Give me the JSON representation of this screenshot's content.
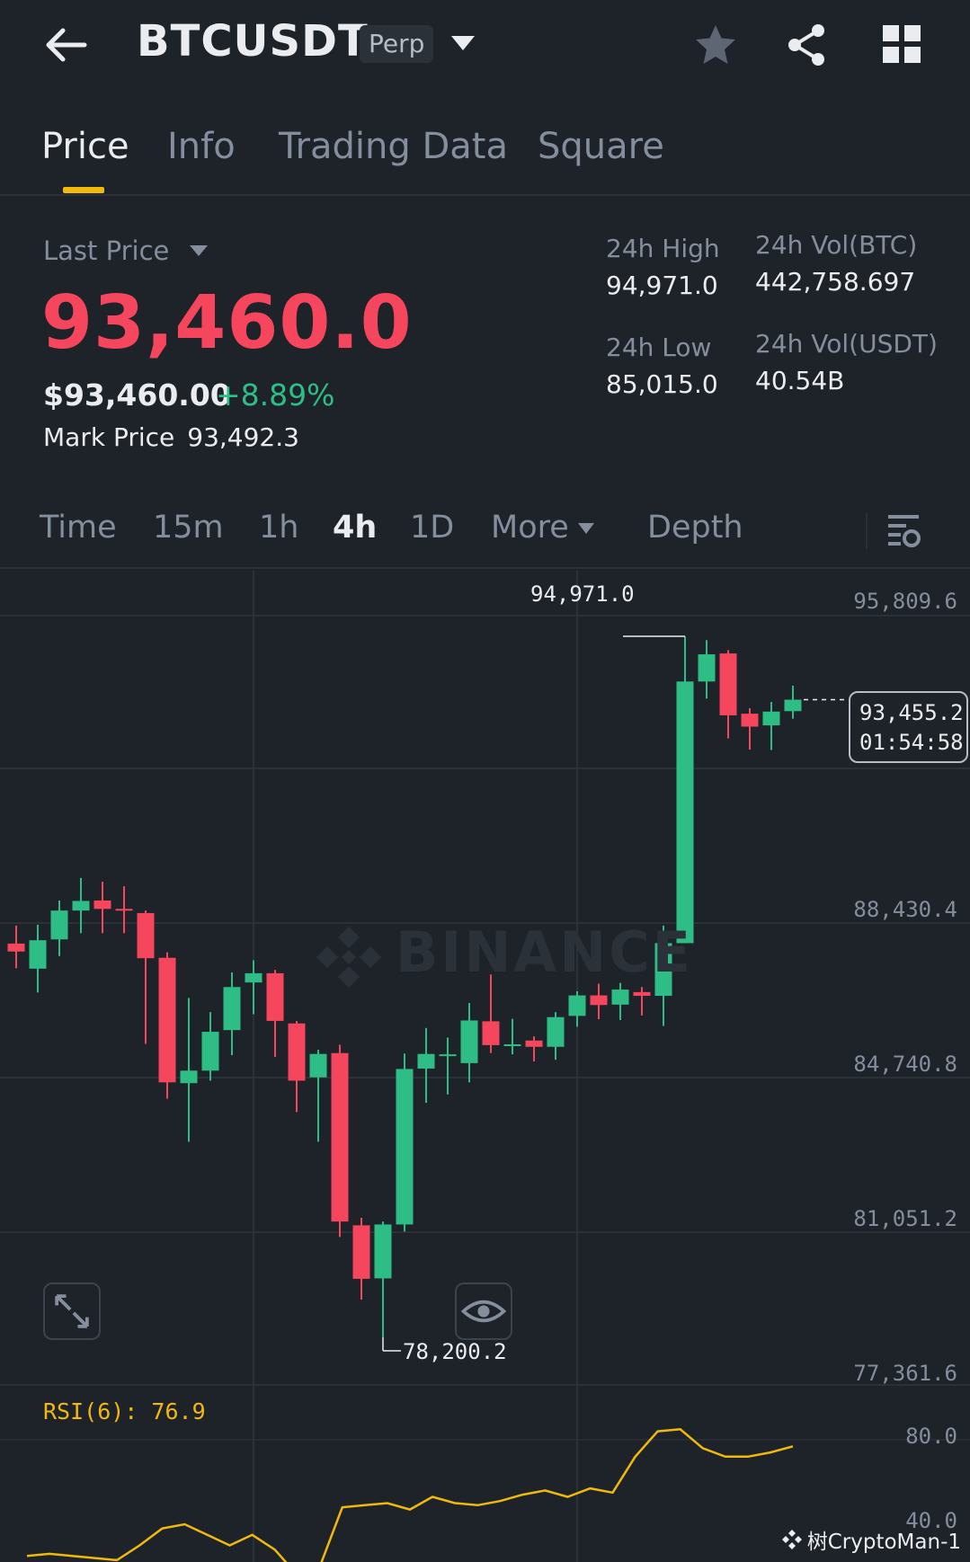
{
  "header": {
    "symbol": "BTCUSDT",
    "contract_type": "Perp",
    "icons": [
      "back-arrow-icon",
      "caret-down-icon",
      "star-icon",
      "share-icon",
      "grid-icon"
    ]
  },
  "tabs": [
    {
      "label": "Price",
      "active": true
    },
    {
      "label": "Info",
      "active": false
    },
    {
      "label": "Trading Data",
      "active": false
    },
    {
      "label": "Square",
      "active": false
    }
  ],
  "summary": {
    "last_price_label": "Last Price",
    "last_price": "93,460.0",
    "usd_price": "$93,460.00",
    "change_pct": "+8.89%",
    "mark_price_label": "Mark Price",
    "mark_price": "93,492.3",
    "high_label": "24h High",
    "high_value": "94,971.0",
    "low_label": "24h Low",
    "low_value": "85,015.0",
    "vol_btc_label": "24h Vol(BTC)",
    "vol_btc_value": "442,758.697",
    "vol_usdt_label": "24h Vol(USDT)",
    "vol_usdt_value": "40.54B"
  },
  "intervals": {
    "items": [
      {
        "label": "Time",
        "active": false
      },
      {
        "label": "15m",
        "active": false
      },
      {
        "label": "1h",
        "active": false
      },
      {
        "label": "4h",
        "active": true
      },
      {
        "label": "1D",
        "active": false
      },
      {
        "label": "More",
        "active": false
      },
      {
        "label": "Depth",
        "active": false
      }
    ]
  },
  "colors": {
    "up": "#2ebd85",
    "down": "#f6465d",
    "accent": "#f0b90b",
    "background": "#1e2329"
  },
  "chart_data": {
    "type": "candlestick",
    "interval": "4h",
    "y_ticks": [
      "95,809.6",
      "88,430.4",
      "84,740.8",
      "81,051.2",
      "77,361.6"
    ],
    "ylim": [
      77361.6,
      95809.6
    ],
    "high_marker": "94,971.0",
    "low_marker": "78,200.2",
    "current_price": "93,455.2",
    "countdown": "01:54:58",
    "watermark": "BINANCE",
    "candles": [
      [
        87620,
        87430,
        88050,
        87030
      ],
      [
        87020,
        87700,
        88070,
        86450
      ],
      [
        87720,
        88410,
        88650,
        87320
      ],
      [
        88410,
        88640,
        89190,
        87870
      ],
      [
        88650,
        88450,
        89100,
        87870
      ],
      [
        88450,
        88410,
        88990,
        87870
      ],
      [
        88350,
        87270,
        88410,
        85220
      ],
      [
        87280,
        84300,
        87410,
        83910
      ],
      [
        84280,
        84580,
        86320,
        82880
      ],
      [
        84580,
        85510,
        85980,
        84340
      ],
      [
        85550,
        86580,
        86930,
        84950
      ],
      [
        86690,
        86910,
        87220,
        85930
      ],
      [
        86910,
        85770,
        86990,
        84910
      ],
      [
        85710,
        84340,
        85770,
        83590
      ],
      [
        84420,
        84980,
        85080,
        82880
      ],
      [
        85000,
        80970,
        85200,
        80600
      ],
      [
        80880,
        79600,
        81060,
        79100
      ],
      [
        79610,
        80900,
        80970,
        78200
      ],
      [
        80900,
        84620,
        84990,
        80730
      ],
      [
        84630,
        84980,
        85600,
        83810
      ],
      [
        84940,
        84970,
        85370,
        84010
      ],
      [
        84760,
        85780,
        86200,
        84300
      ],
      [
        85760,
        85190,
        86880,
        85000
      ],
      [
        85190,
        85210,
        85820,
        84970
      ],
      [
        85300,
        85150,
        85400,
        84800
      ],
      [
        85150,
        85860,
        85980,
        84840
      ],
      [
        85890,
        86380,
        86480,
        85630
      ],
      [
        86380,
        86150,
        86660,
        85810
      ],
      [
        86160,
        86520,
        86680,
        85790
      ],
      [
        86460,
        86370,
        86580,
        85900
      ],
      [
        86370,
        87630,
        88050,
        85650
      ],
      [
        87630,
        93890,
        94971,
        87630
      ],
      [
        93890,
        94540,
        94880,
        93480
      ],
      [
        94560,
        93080,
        94640,
        92530
      ],
      [
        93120,
        92810,
        93250,
        92260
      ],
      [
        92840,
        93170,
        93400,
        92250
      ],
      [
        93180,
        93455,
        93790,
        93000
      ]
    ],
    "rsi": {
      "label": "RSI(6): 76.9",
      "y_ticks": [
        "80.0",
        "40.0"
      ],
      "values": [
        25,
        26,
        25,
        24,
        23,
        30,
        38,
        40,
        35,
        30,
        35,
        28,
        16,
        20,
        48,
        49,
        50,
        47,
        53,
        50,
        49,
        51,
        54,
        56,
        53,
        57,
        55,
        72,
        84,
        85,
        76,
        72,
        72,
        74,
        76.9
      ]
    }
  },
  "credit": {
    "text": "树CryptoMan-1"
  }
}
